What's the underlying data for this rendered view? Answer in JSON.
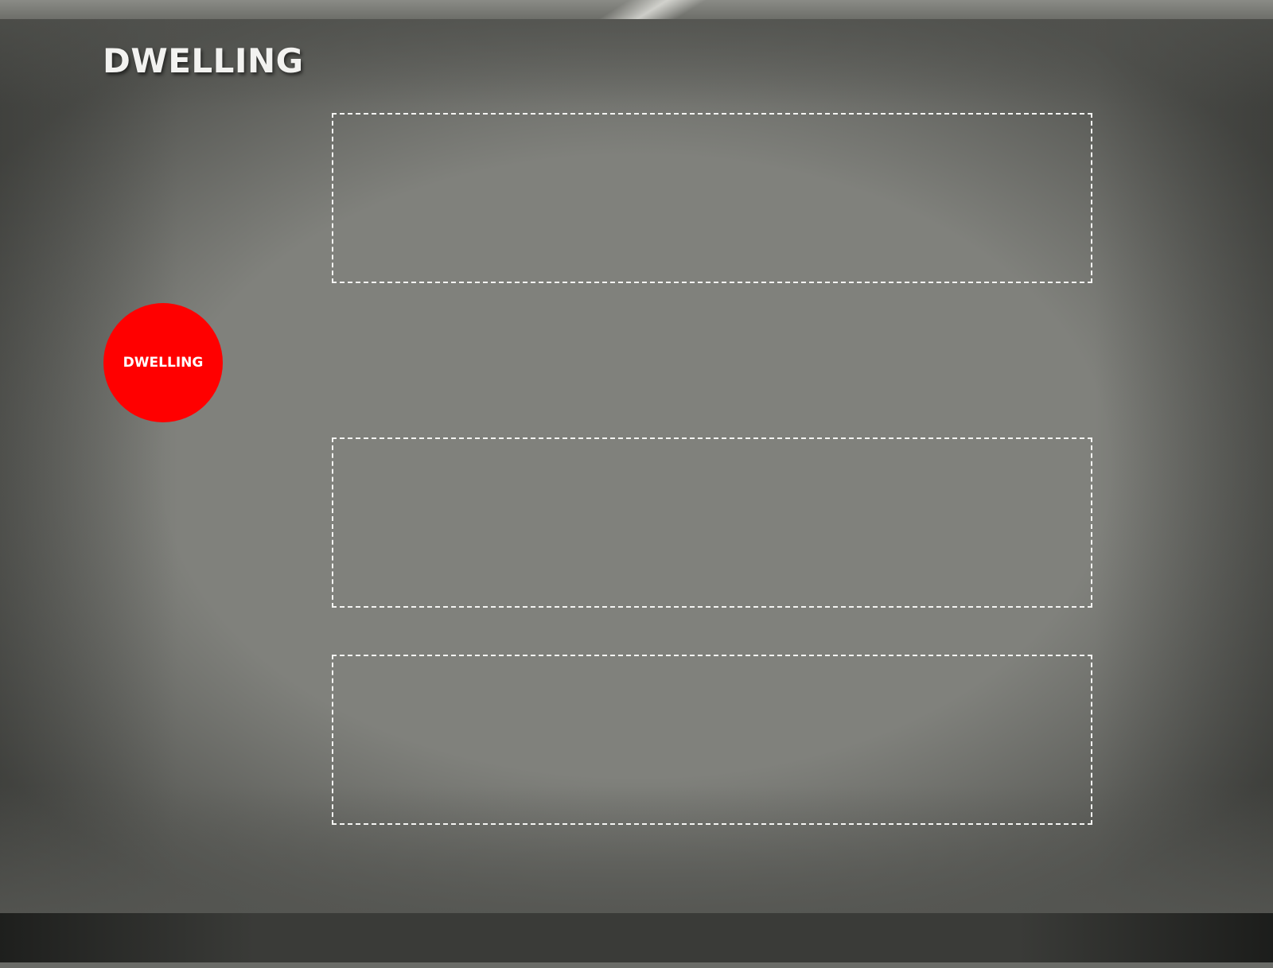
{
  "slide": {
    "title": "DWELLING",
    "badge_label": "DWELLING",
    "badge_color": "#ff0000",
    "placeholders": [
      "",
      "",
      ""
    ]
  },
  "theme": {
    "background": "#80817c",
    "title_color": "#f2f2f0",
    "placeholder_border": "#f4f4f2"
  }
}
